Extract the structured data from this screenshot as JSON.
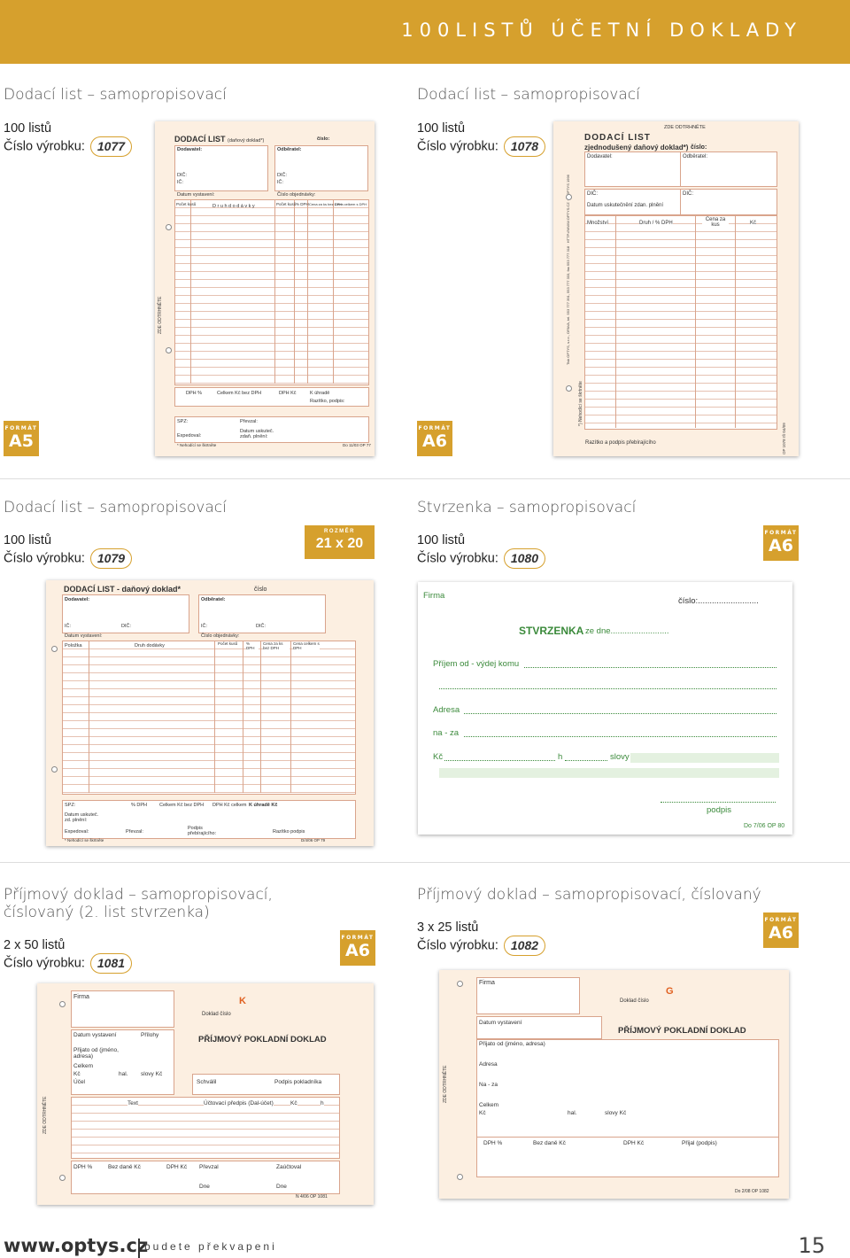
{
  "header": {
    "title": "100LISTŮ ÚČETNÍ DOKLADY"
  },
  "labels": {
    "listu_100": "100 listů",
    "cislo_vyrobku": "Číslo výrobku:",
    "format": "FORMÁT",
    "rozmer": "ROZMĚR"
  },
  "p1077": {
    "title": "Dodací list – samopropisovací",
    "count": "100 listů",
    "code": "1077",
    "format": "A5",
    "doc": {
      "heading": "DODACÍ LIST",
      "heading_sub": "(daňový doklad*)",
      "cislo": "číslo:",
      "dodavatel": "Dodavatel:",
      "odberatel": "Odběratel:",
      "dic": "DIČ:",
      "ic": "IČ:",
      "datum_vystaveni": "Datum vystavení:",
      "cislo_objednavky": "Číslo objednávky:",
      "col_pocet": "Počet kusů",
      "col_druh": "D r u h  d o d á v k y",
      "col_pocet2": "Počet kusů",
      "col_dph": "% DPH",
      "col_cena": "Cena za ks bez DPH",
      "col_celkem": "Cena celkem s DPH",
      "dph": "DPH %",
      "celkem_bez": "Celkem Kč bez DPH",
      "dph_kc": "DPH Kč",
      "k_uhrade": "K úhradě",
      "razitko": "Razítko, podpis:",
      "spz": "SPZ:",
      "prevzal": "Převzal:",
      "expedoval": "Expedoval:",
      "datum_uskut": "Datum uskuteč. zdaň. plnění:",
      "footnote": "* Nehodící se škrtněte",
      "code": "Do 11/03 OP 77",
      "zde": "ZDE ODTRHNĚTE"
    }
  },
  "p1078": {
    "title": "Dodací list – samopropisovací",
    "count": "100 listů",
    "code": "1078",
    "format": "A6",
    "doc": {
      "zde": "ZDE ODTRHNĚTE",
      "heading": "DODACÍ LIST",
      "heading2": "zjednodušený daňový doklad*)",
      "cislo": "číslo:",
      "dodavatel": "Dodavatel:",
      "odberatel": "Odběratel:",
      "dic1": "DIČ:",
      "dic2": "DIČ:",
      "datum": "Datum uskutečnění zdan. plnění",
      "col_mnozstvi": "Množství",
      "col_druh": "Druh / % DPH",
      "col_cena": "Cena za kus",
      "col_kc": "Kč",
      "nehodici": "*) Nehodící se škrtněte",
      "razitko": "Razítko a podpis přebírajícího",
      "code": "OP 1078  IŠ 04/09",
      "vert": "Tisk OPTYS, s.r.o., OPAVA, tel. 553 777 391, 553 777 333, fax 553 777 318 · HTTP://WWW.OPTYS.CZ · © OPTYS 1996"
    }
  },
  "p1079": {
    "title": "Dodací list – samopropisovací",
    "count": "100 listů",
    "code": "1079",
    "size": "21 x 20 cm",
    "doc": {
      "heading": "DODACÍ  LIST - daňový doklad*",
      "cislo": "číslo",
      "dodavatel": "Dodavatel:",
      "odberatel": "Odběratel:",
      "ic": "IČ:",
      "dic": "DIČ:",
      "ic2": "IČ:",
      "dic2": "DIČ:",
      "datum": "Datum vystavení:",
      "objednavka": "Číslo objednávky:",
      "col_pol": "Položka",
      "col_druh": "Druh dodávky",
      "col_pocet": "Počet kusů",
      "col_dph": "% DPH",
      "col_cena": "Cena za ks bez DPH",
      "col_celkem": "Cena celkem s DPH",
      "spz": "SPZ:",
      "pdph": "% DPH",
      "celkem": "Celkem Kč bez DPH",
      "dphkc": "DPH Kč celkem",
      "kuhrade": "K úhradě Kč",
      "datum_usk": "Datum uskuteč. zd. plnění:",
      "expedoval": "Expedoval:",
      "prevzal": "Převzal:",
      "podpis": "Podpis přebírajícího:",
      "razitko": "Razítko podpis",
      "nehodici": "* Nehodící se škrtněte",
      "code": "D/4/06  OP 79"
    }
  },
  "p1080": {
    "title": "Stvrzenka – samopropisovací",
    "count": "100 listů",
    "code": "1080",
    "format": "A6",
    "doc": {
      "firma": "Firma",
      "cislo": "číslo:..........................",
      "stvrzenka": "STVRZENKA",
      "ze_dne": "ze dne.........................",
      "prijem": "Příjem od - výdej komu",
      "adresa": "Adresa",
      "na_za": "na - za",
      "kc": "Kč",
      "h": "h",
      "slovy": "slovy",
      "podpis": "podpis",
      "code": "Do 7/06  OP 80"
    }
  },
  "p1081": {
    "title": "Příjmový doklad – samopropisovací, číslovaný (2. list stvrzenka)",
    "count": "2 x 50 listů",
    "code": "1081",
    "format": "A6",
    "doc": {
      "firma": "Firma",
      "letter": "K",
      "doklad_cislo": "Doklad číslo",
      "datum": "Datum vystavení",
      "prilohy": "Přílohy",
      "heading": "PŘÍJMOVÝ POKLADNÍ DOKLAD",
      "prijato": "Přijato od (jméno, adresa)",
      "celkem": "Celkem",
      "kc": "Kč",
      "hal": "hal.",
      "slovy": "slovy Kč",
      "ucel": "Účel",
      "schvalil": "Schválil",
      "podpis": "Podpis pokladníka",
      "text": "Text",
      "ucetni": "Účtovací předpis (Dal-účet)",
      "col_kc": "Kč",
      "col_h": "h",
      "dph": "DPH %",
      "bez_dane": "Bez daně Kč",
      "dph_kc": "DPH Kč",
      "prevzal": "Převzal",
      "zauctoval": "Zaúčtoval",
      "dne1": "Dne",
      "dne2": "Dne",
      "code": "N 4/06  OP 1081",
      "zde": "ZDE ODTRHNĚTE"
    }
  },
  "p1082": {
    "title": "Příjmový doklad – samopropisovací, číslovaný",
    "count": "3 x 25 listů",
    "code": "1082",
    "format": "A6",
    "doc": {
      "firma": "Firma",
      "letter": "G",
      "doklad_cislo": "Doklad číslo",
      "datum": "Datum vystavení",
      "heading": "PŘÍJMOVÝ POKLADNÍ DOKLAD",
      "prijato": "Přijato od (jméno, adresa)",
      "adresa": "Adresa",
      "na_za": "Na - za",
      "celkem": "Celkem",
      "kc": "Kč",
      "hal": "hal.",
      "slovy": "slovy Kč",
      "dph": "DPH %",
      "bez_dane": "Bez daně Kč",
      "dph_kc": "DPH Kč",
      "prijal": "Přijal (podpis)",
      "code": "Do 2/08  OP 1082",
      "zde": "ZDE ODTRHNĚTE"
    }
  },
  "footer": {
    "url": "www.optys.cz",
    "tagline": "budete překvapeni",
    "page": "15"
  }
}
